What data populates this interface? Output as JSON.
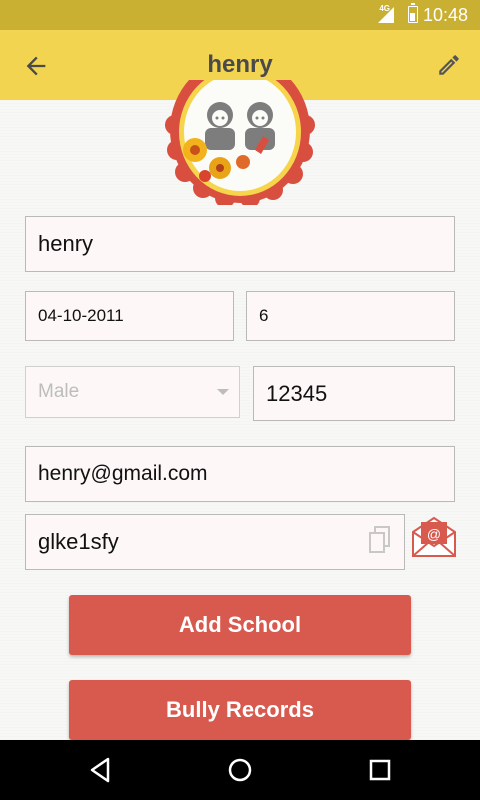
{
  "status_bar": {
    "network": "4G",
    "time": "10:48"
  },
  "toolbar": {
    "title": "henry",
    "back_icon": "arrow-left-icon",
    "edit_icon": "pencil-icon"
  },
  "profile": {
    "name": "henry",
    "dob": "04-10-2011",
    "age": "6",
    "gender_placeholder": "Male",
    "zip": "12345",
    "email": "henry@gmail.com",
    "code": "glke1sfy"
  },
  "buttons": {
    "add_school": "Add School",
    "bully_records": "Bully Records"
  },
  "colors": {
    "status_bar": "#c9b032",
    "toolbar": "#f2d450",
    "button": "#d85a4e",
    "field_bg": "#fdf7f7"
  }
}
